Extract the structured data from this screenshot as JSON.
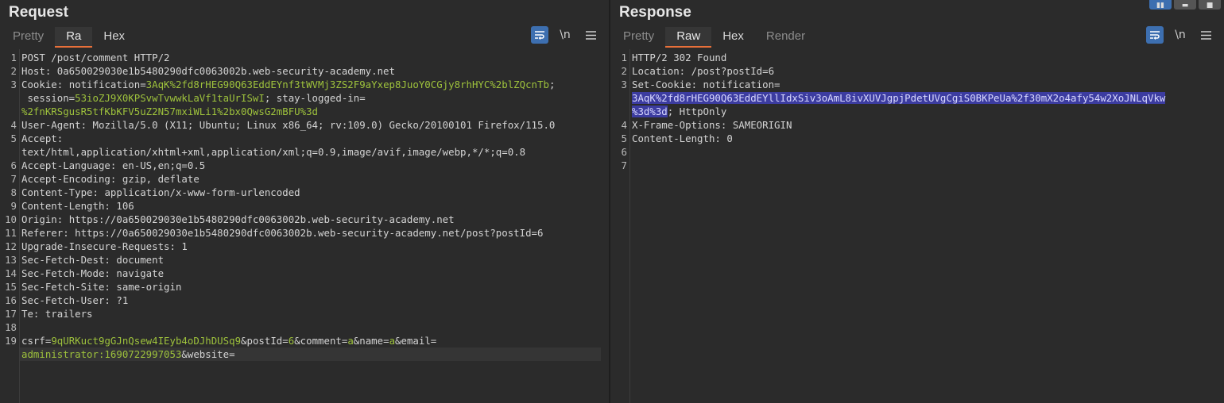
{
  "request": {
    "title": "Request",
    "tabs": [
      {
        "label": "Pretty",
        "state": "dim"
      },
      {
        "label": "Ra",
        "state": "active"
      },
      {
        "label": "Hex",
        "state": "normal"
      }
    ],
    "toolbar": {
      "wrap_icon": "wrap-lines-icon",
      "newline_label": "\\n",
      "menu_icon": "hamburger-menu-icon"
    },
    "lines": [
      {
        "n": "1",
        "parts": [
          {
            "t": "POST /post/comment HTTP/2",
            "c": "val"
          }
        ]
      },
      {
        "n": "2",
        "parts": [
          {
            "t": "Host: ",
            "c": "hk"
          },
          {
            "t": "0a650029030e1b5480290dfc0063002b.web-security-academy.net",
            "c": "val"
          }
        ]
      },
      {
        "n": "3",
        "parts": [
          {
            "t": "Cookie: ",
            "c": "hk"
          },
          {
            "t": "notification=",
            "c": "val"
          },
          {
            "t": "3AqK%2fd8rHEG90Q63EddEYnf3tWVMj3ZS2F9aYxep8JuoY0CGjy8rhHYC%2blZQcnTb",
            "c": "gv"
          },
          {
            "t": ";",
            "c": "val"
          }
        ]
      },
      {
        "n": "",
        "parts": [
          {
            "t": " session=",
            "c": "val"
          },
          {
            "t": "53ioZJ9X0KPSvwTvwwkLaVf1taUrISwI",
            "c": "gv"
          },
          {
            "t": "; stay-logged-in=",
            "c": "val"
          }
        ]
      },
      {
        "n": "",
        "parts": [
          {
            "t": "%2fnKRSgusR5tfKbKFV5uZ2N57mxiWLi1%2bx0QwsG2mBFU%3d",
            "c": "gv"
          }
        ]
      },
      {
        "n": "4",
        "parts": [
          {
            "t": "User-Agent: ",
            "c": "hk"
          },
          {
            "t": "Mozilla/5.0 (X11; Ubuntu; Linux x86_64; rv:109.0) Gecko/20100101 Firefox/115.0",
            "c": "val"
          }
        ]
      },
      {
        "n": "5",
        "parts": [
          {
            "t": "Accept: ",
            "c": "hk"
          }
        ]
      },
      {
        "n": "",
        "parts": [
          {
            "t": "text/html,application/xhtml+xml,application/xml;q=0.9,image/avif,image/webp,*/*;q=0.8",
            "c": "val"
          }
        ]
      },
      {
        "n": "6",
        "parts": [
          {
            "t": "Accept-Language: ",
            "c": "hk"
          },
          {
            "t": "en-US,en;q=0.5",
            "c": "val"
          }
        ]
      },
      {
        "n": "7",
        "parts": [
          {
            "t": "Accept-Encoding: ",
            "c": "hk"
          },
          {
            "t": "gzip, deflate",
            "c": "val"
          }
        ]
      },
      {
        "n": "8",
        "parts": [
          {
            "t": "Content-Type: ",
            "c": "hk"
          },
          {
            "t": "application/x-www-form-urlencoded",
            "c": "val"
          }
        ]
      },
      {
        "n": "9",
        "parts": [
          {
            "t": "Content-Length: ",
            "c": "hk"
          },
          {
            "t": "106",
            "c": "val"
          }
        ]
      },
      {
        "n": "10",
        "parts": [
          {
            "t": "Origin: ",
            "c": "hk"
          },
          {
            "t": "https://0a650029030e1b5480290dfc0063002b.web-security-academy.net",
            "c": "val"
          }
        ]
      },
      {
        "n": "11",
        "parts": [
          {
            "t": "Referer: ",
            "c": "hk"
          },
          {
            "t": "https://0a650029030e1b5480290dfc0063002b.web-security-academy.net/post?postId=6",
            "c": "val"
          }
        ]
      },
      {
        "n": "12",
        "parts": [
          {
            "t": "Upgrade-Insecure-Requests: ",
            "c": "hk"
          },
          {
            "t": "1",
            "c": "val"
          }
        ]
      },
      {
        "n": "13",
        "parts": [
          {
            "t": "Sec-Fetch-Dest: ",
            "c": "hk"
          },
          {
            "t": "document",
            "c": "val"
          }
        ]
      },
      {
        "n": "14",
        "parts": [
          {
            "t": "Sec-Fetch-Mode: ",
            "c": "hk"
          },
          {
            "t": "navigate",
            "c": "val"
          }
        ]
      },
      {
        "n": "15",
        "parts": [
          {
            "t": "Sec-Fetch-Site: ",
            "c": "hk"
          },
          {
            "t": "same-origin",
            "c": "val"
          }
        ]
      },
      {
        "n": "16",
        "parts": [
          {
            "t": "Sec-Fetch-User: ",
            "c": "hk"
          },
          {
            "t": "?1",
            "c": "val"
          }
        ]
      },
      {
        "n": "17",
        "parts": [
          {
            "t": "Te: ",
            "c": "hk"
          },
          {
            "t": "trailers",
            "c": "val"
          }
        ]
      },
      {
        "n": "18",
        "parts": []
      },
      {
        "n": "19",
        "parts": [
          {
            "t": "csrf=",
            "c": "val"
          },
          {
            "t": "9qURKuct9gGJnQsew4IEyb4oDJhDUSq9",
            "c": "gv"
          },
          {
            "t": "&postId=",
            "c": "val"
          },
          {
            "t": "6",
            "c": "gv"
          },
          {
            "t": "&comment=",
            "c": "val"
          },
          {
            "t": "a",
            "c": "gv"
          },
          {
            "t": "&name=",
            "c": "val"
          },
          {
            "t": "a",
            "c": "gv"
          },
          {
            "t": "&email=",
            "c": "val"
          }
        ]
      },
      {
        "n": "",
        "current": true,
        "parts": [
          {
            "t": "administrator:1690722997053",
            "c": "gv"
          },
          {
            "t": "&website=",
            "c": "val"
          }
        ]
      }
    ]
  },
  "response": {
    "title": "Response",
    "tabs": [
      {
        "label": "Pretty",
        "state": "dim"
      },
      {
        "label": "Raw",
        "state": "active"
      },
      {
        "label": "Hex",
        "state": "normal"
      },
      {
        "label": "Render",
        "state": "dim"
      }
    ],
    "toolbar": {
      "wrap_icon": "wrap-lines-icon",
      "newline_label": "\\n",
      "menu_icon": "hamburger-menu-icon"
    },
    "lines": [
      {
        "n": "1",
        "parts": [
          {
            "t": "HTTP/2 302 Found",
            "c": "val"
          }
        ]
      },
      {
        "n": "2",
        "parts": [
          {
            "t": "Location: ",
            "c": "hk"
          },
          {
            "t": "/post?postId=6",
            "c": "val"
          }
        ]
      },
      {
        "n": "3",
        "parts": [
          {
            "t": "Set-Cookie: ",
            "c": "hk"
          },
          {
            "t": "notification=",
            "c": "val"
          }
        ]
      },
      {
        "n": "",
        "parts": [
          {
            "t": "3AqK%2fd8rHEG90Q63EddEYllIdxSiv3oAmL8ivXUVJgpjPdetUVgCgiS0BKPeUa%2f30mX2o4afy54w2XoJNLqVkw",
            "c": "hl"
          }
        ]
      },
      {
        "n": "",
        "parts": [
          {
            "t": "%3d%3d",
            "c": "hl"
          },
          {
            "t": "; HttpOnly",
            "c": "val"
          }
        ]
      },
      {
        "n": "4",
        "parts": [
          {
            "t": "X-Frame-Options: ",
            "c": "hk"
          },
          {
            "t": "SAMEORIGIN",
            "c": "val"
          }
        ]
      },
      {
        "n": "5",
        "parts": [
          {
            "t": "Content-Length: ",
            "c": "hk"
          },
          {
            "t": "0",
            "c": "val"
          }
        ]
      },
      {
        "n": "6",
        "parts": []
      },
      {
        "n": "7",
        "parts": []
      }
    ]
  },
  "layout_buttons": [
    {
      "name": "layout-side-by-side-icon",
      "state": "on"
    },
    {
      "name": "layout-stacked-icon",
      "state": "off"
    },
    {
      "name": "layout-tabs-icon",
      "state": "off"
    }
  ]
}
